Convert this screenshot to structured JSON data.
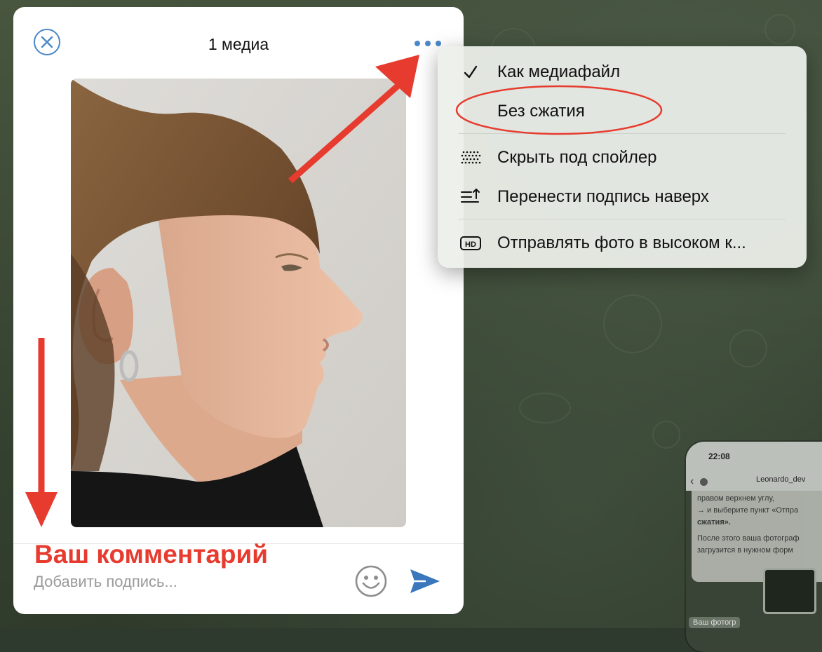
{
  "dialog": {
    "title": "1 медиа",
    "comment_label": "Ваш комментарий",
    "caption_placeholder": "Добавить подпись..."
  },
  "menu": {
    "items": [
      {
        "label": "Как медиафайл",
        "icon": "checkmark-icon",
        "checked": true
      },
      {
        "label": "Без сжатия",
        "icon": "",
        "highlighted": true
      },
      {
        "label": "Скрыть под спойлер",
        "icon": "spoiler-dots-icon"
      },
      {
        "label": "Перенести подпись наверх",
        "icon": "caption-up-icon"
      },
      {
        "label": "Отправлять фото в высоком к...",
        "icon": "hd-icon"
      }
    ]
  },
  "phone_preview": {
    "time": "22:08",
    "name": "Leonardo_dev",
    "lines": [
      "правом верхнем углу,",
      "→ и выберите пункт «Отпра",
      "сжатия».",
      "После этого ваша фотограф",
      "загрузится в нужном форм"
    ],
    "footer": "Ваш фотогр"
  },
  "colors": {
    "accent": "#4a87c9",
    "annotation_red": "#e63b2e",
    "dialog_bg": "#ffffff",
    "menu_bg": "#eceeea",
    "wallpaper": "#3a4636"
  }
}
